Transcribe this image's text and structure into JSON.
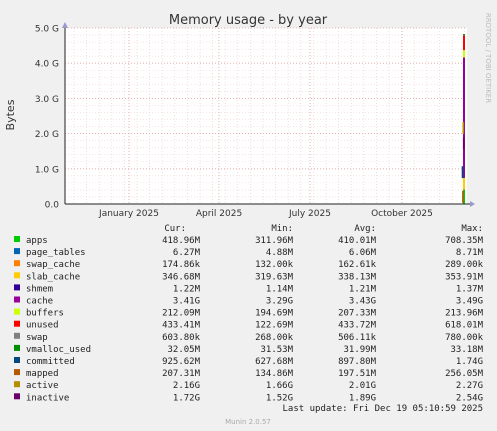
{
  "chart_data": {
    "type": "area",
    "title": "Memory usage - by year",
    "ylabel": "Bytes",
    "side_label": "RRDTOOL / TOBI OETIKER",
    "y_ticks": [
      "0.0",
      "1.0 G",
      "2.0 G",
      "3.0 G",
      "4.0 G",
      "5.0 G"
    ],
    "ylim": [
      0,
      5.0
    ],
    "y_unit": "G",
    "x_ticks": [
      "January 2025",
      "April 2025",
      "July 2025",
      "October 2025"
    ],
    "grid": true,
    "columns": [
      "Cur:",
      "Min:",
      "Avg:",
      "Max:"
    ],
    "series": [
      {
        "name": "apps",
        "color": "#00cc00",
        "cur": "418.96M",
        "min": "311.96M",
        "avg": "410.01M",
        "max": "708.35M"
      },
      {
        "name": "page_tables",
        "color": "#0066b3",
        "cur": "6.27M",
        "min": "4.88M",
        "avg": "6.06M",
        "max": "8.71M"
      },
      {
        "name": "swap_cache",
        "color": "#ff8000",
        "cur": "174.86k",
        "min": "132.00k",
        "avg": "162.61k",
        "max": "289.00k"
      },
      {
        "name": "slab_cache",
        "color": "#ffcc00",
        "cur": "346.68M",
        "min": "319.63M",
        "avg": "338.13M",
        "max": "353.91M"
      },
      {
        "name": "shmem",
        "color": "#330099",
        "cur": "1.22M",
        "min": "1.14M",
        "avg": "1.21M",
        "max": "1.37M"
      },
      {
        "name": "cache",
        "color": "#990099",
        "cur": "3.41G",
        "min": "3.29G",
        "avg": "3.43G",
        "max": "3.49G"
      },
      {
        "name": "buffers",
        "color": "#ccff00",
        "cur": "212.09M",
        "min": "194.69M",
        "avg": "207.33M",
        "max": "213.96M"
      },
      {
        "name": "unused",
        "color": "#ff0000",
        "cur": "433.41M",
        "min": "122.69M",
        "avg": "433.72M",
        "max": "618.01M"
      },
      {
        "name": "swap",
        "color": "#808080",
        "cur": "603.80k",
        "min": "268.00k",
        "avg": "506.11k",
        "max": "780.00k"
      },
      {
        "name": "vmalloc_used",
        "color": "#008f00",
        "cur": "32.05M",
        "min": "31.53M",
        "avg": "31.99M",
        "max": "33.18M"
      },
      {
        "name": "committed",
        "color": "#00487d",
        "cur": "925.62M",
        "min": "627.68M",
        "avg": "897.80M",
        "max": "1.74G"
      },
      {
        "name": "mapped",
        "color": "#b35a00",
        "cur": "207.31M",
        "min": "134.86M",
        "avg": "197.51M",
        "max": "256.05M"
      },
      {
        "name": "active",
        "color": "#b38f00",
        "cur": "2.16G",
        "min": "1.66G",
        "avg": "2.01G",
        "max": "2.27G"
      },
      {
        "name": "inactive",
        "color": "#6b006b",
        "cur": "1.72G",
        "min": "1.52G",
        "avg": "1.89G",
        "max": "2.54G"
      }
    ],
    "last_update": "Last update: Fri Dec 19 05:10:59 2025",
    "footer": "Munin 2.0.57"
  }
}
